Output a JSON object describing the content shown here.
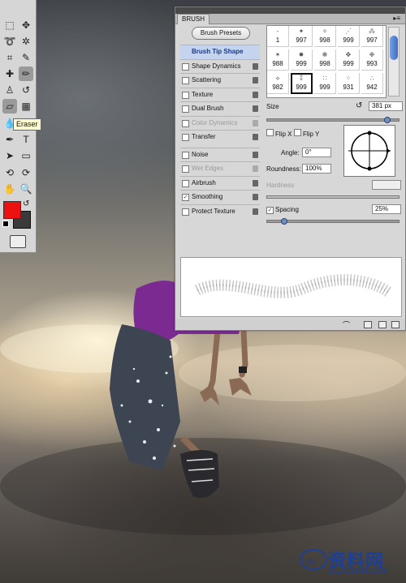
{
  "colors": {
    "foreground": "#ee1111",
    "background": "#3a3a3a",
    "accent": "#3a6cc8"
  },
  "tools": {
    "tooltip": "Eraser",
    "icons": [
      "marquee-icon",
      "move-icon",
      "lasso-icon",
      "magic-wand-icon",
      "crop-icon",
      "eyedropper-icon",
      "healing-brush-icon",
      "brush-icon",
      "clone-stamp-icon",
      "history-brush-icon",
      "eraser-icon",
      "gradient-icon",
      "blur-icon",
      "dodge-icon",
      "pen-icon",
      "type-icon",
      "path-selection-icon",
      "shape-icon",
      "3d-rotate-icon",
      "3d-orbit-icon",
      "hand-icon",
      "zoom-icon"
    ]
  },
  "panel": {
    "tab": "BRUSH",
    "menu": "▸≡",
    "presets_button": "Brush Presets",
    "options": [
      {
        "label": "Brush Tip Shape",
        "checked": null,
        "active": true,
        "disabled": false,
        "lock": false
      },
      {
        "label": "Shape Dynamics",
        "checked": false,
        "disabled": false,
        "lock": true
      },
      {
        "label": "Scattering",
        "checked": false,
        "disabled": false,
        "lock": true
      },
      {
        "label": "Texture",
        "checked": false,
        "disabled": false,
        "lock": true
      },
      {
        "label": "Dual Brush",
        "checked": false,
        "disabled": false,
        "lock": true
      },
      {
        "label": "Color Dynamics",
        "checked": false,
        "disabled": true,
        "lock": true
      },
      {
        "label": "Transfer",
        "checked": false,
        "disabled": false,
        "lock": true
      },
      {
        "label": "Noise",
        "checked": false,
        "disabled": false,
        "lock": true
      },
      {
        "label": "Wet Edges",
        "checked": false,
        "disabled": true,
        "lock": true
      },
      {
        "label": "Airbrush",
        "checked": false,
        "disabled": false,
        "lock": true
      },
      {
        "label": "Smoothing",
        "checked": true,
        "disabled": false,
        "lock": true
      },
      {
        "label": "Protect Texture",
        "checked": false,
        "disabled": false,
        "lock": true
      }
    ],
    "brushes": [
      {
        "mark": "-",
        "size": "1"
      },
      {
        "mark": "✦",
        "size": "997"
      },
      {
        "mark": "✧",
        "size": "998"
      },
      {
        "mark": "⋰",
        "size": "999"
      },
      {
        "mark": "⁂",
        "size": "997"
      },
      {
        "mark": "✶",
        "size": "988"
      },
      {
        "mark": "✸",
        "size": "999"
      },
      {
        "mark": "❋",
        "size": "998"
      },
      {
        "mark": "✥",
        "size": "999"
      },
      {
        "mark": "❉",
        "size": "993"
      },
      {
        "mark": "⟡",
        "size": "982"
      },
      {
        "mark": "⁑",
        "size": "999",
        "selected": true
      },
      {
        "mark": "∷",
        "size": "999"
      },
      {
        "mark": "⁘",
        "size": "931"
      },
      {
        "mark": "∴",
        "size": "942"
      }
    ],
    "size_label": "Size",
    "size_value": "381 px",
    "flip_x": "Flip X",
    "flip_y": "Flip Y",
    "angle_label": "Angle:",
    "angle_value": "0°",
    "roundness_label": "Roundness:",
    "roundness_value": "100%",
    "hardness_label": "Hardness",
    "spacing_label": "Spacing",
    "spacing_value": "25%",
    "size_slider_level": 0.9,
    "spacing_slider_level": 0.13
  },
  "watermark": {
    "title": "资料网",
    "sub": "ZL.XS1616.COM"
  }
}
